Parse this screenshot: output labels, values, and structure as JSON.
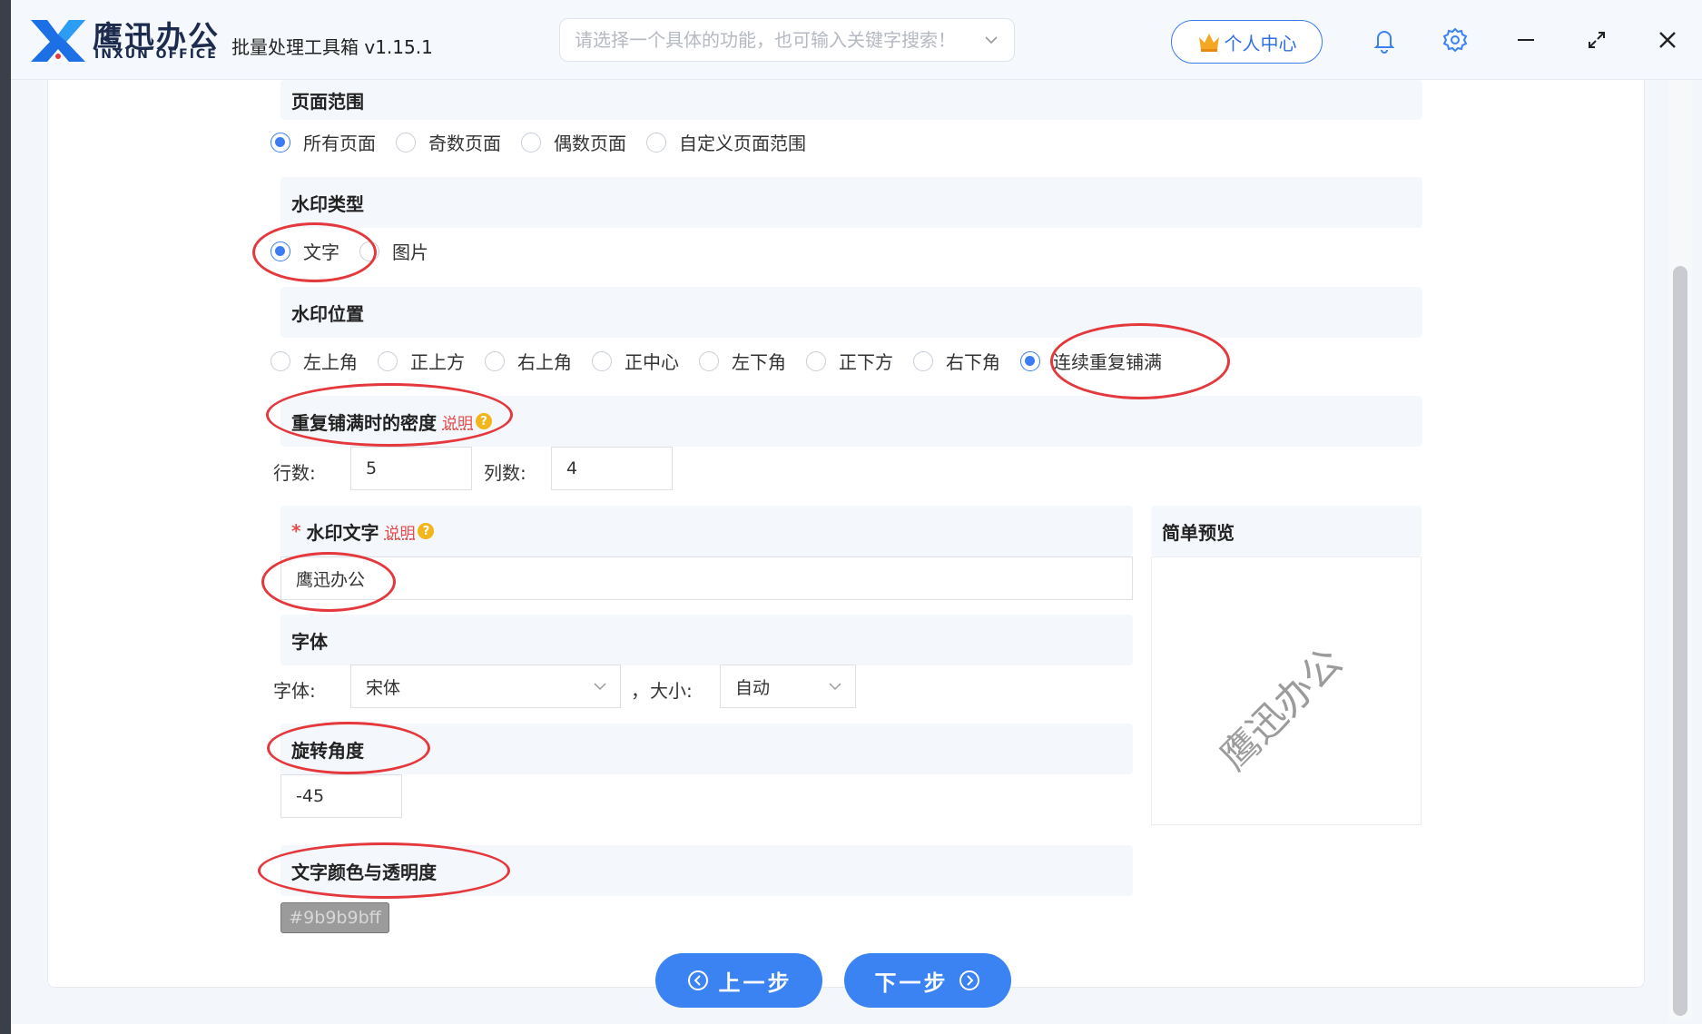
{
  "app": {
    "brand_cn": "鹰迅办公",
    "brand_en": "INXUN OFFICE",
    "title": "批量处理工具箱 v1.15.1",
    "search_placeholder": "请选择一个具体的功能，也可输入关键字搜索！",
    "user_center": "个人中心",
    "icons": [
      "bell-icon",
      "gear-icon",
      "minimize-icon",
      "expand-icon",
      "close-icon"
    ]
  },
  "page_range": {
    "title": "页面范围",
    "options": [
      "所有页面",
      "奇数页面",
      "偶数页面",
      "自定义页面范围"
    ],
    "selected": "所有页面"
  },
  "wm_type": {
    "title": "水印类型",
    "options": [
      "文字",
      "图片"
    ],
    "selected": "文字"
  },
  "wm_position": {
    "title": "水印位置",
    "options": [
      "左上角",
      "正上方",
      "右上角",
      "正中心",
      "左下角",
      "正下方",
      "右下角",
      "连续重复铺满"
    ],
    "selected": "连续重复铺满"
  },
  "density": {
    "title": "重复铺满时的密度",
    "hint": "说明",
    "rows_label": "行数:",
    "rows_value": "5",
    "cols_label": "列数:",
    "cols_value": "4"
  },
  "wm_text": {
    "title": "水印文字",
    "hint": "说明",
    "value": "鹰迅办公"
  },
  "font": {
    "title": "字体",
    "font_label": "字体:",
    "font_value": "宋体",
    "sep": "，",
    "size_label": "大小:",
    "size_value": "自动"
  },
  "rotation": {
    "title": "旋转角度",
    "value": "-45"
  },
  "color": {
    "title": "文字颜色与透明度",
    "value": "#9b9b9bff"
  },
  "preview": {
    "title": "简单预览",
    "text": "鹰迅办公"
  },
  "nav": {
    "prev": "上一步",
    "next": "下一步"
  },
  "colors": {
    "accent": "#3b82f2",
    "annotation": "#e4383d",
    "watermark": "#9b9b9b"
  }
}
